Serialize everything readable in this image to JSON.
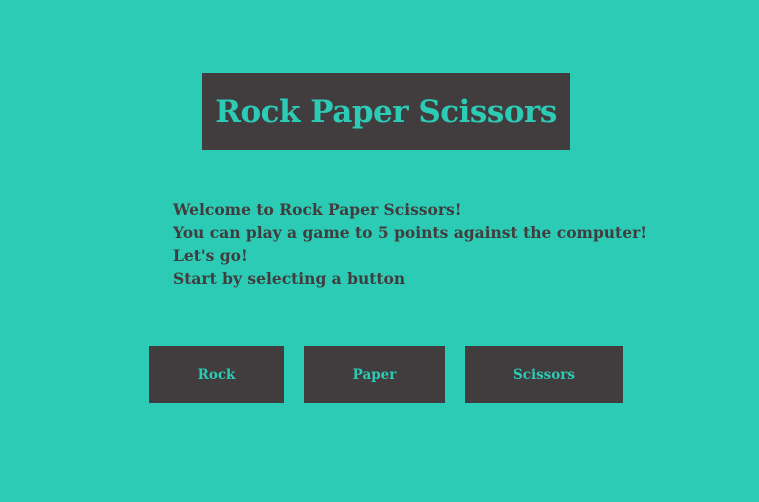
{
  "header": {
    "title": "Rock Paper Scissors"
  },
  "messages": {
    "line1": "Welcome to Rock Paper Scissors!",
    "line2": "You can play a game to 5 points against the computer!",
    "line3": "Let's go!",
    "line4": "Start by selecting a button"
  },
  "buttons": {
    "rock": "Rock",
    "paper": "Paper",
    "scissors": "Scissors"
  },
  "colors": {
    "background": "#2ccbb5",
    "panel": "#413c3d",
    "accent_text": "#2ccbb5"
  }
}
